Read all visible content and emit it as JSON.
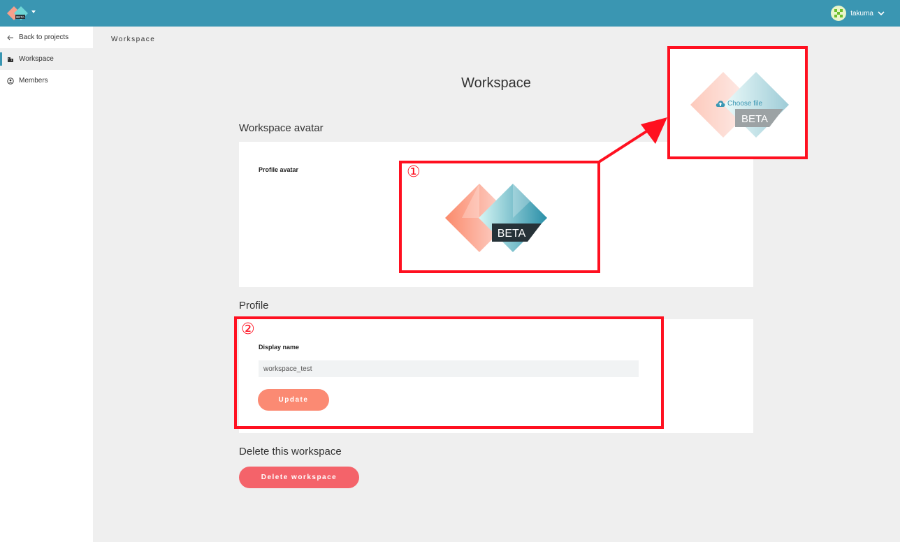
{
  "header": {
    "user_name": "takuma",
    "logo_badge": "BETA"
  },
  "sidebar": {
    "items": [
      {
        "label": "Back to projects",
        "icon": "arrow-left-icon"
      },
      {
        "label": "Workspace",
        "icon": "building-icon",
        "active": true
      },
      {
        "label": "Members",
        "icon": "user-circle-icon"
      }
    ]
  },
  "breadcrumb": "Workspace",
  "page": {
    "title": "Workspace"
  },
  "avatar_section": {
    "heading": "Workspace avatar",
    "field_label": "Profile avatar",
    "badge": "BETA"
  },
  "profile_section": {
    "heading": "Profile",
    "field_label": "Display name",
    "display_name_value": "workspace_test",
    "update_label": "Update"
  },
  "delete_section": {
    "heading": "Delete this workspace",
    "button_label": "Delete workspace"
  },
  "annotations": {
    "marker_1": "①",
    "marker_2": "②",
    "choose_file_label": "Choose file",
    "badge": "BETA"
  },
  "colors": {
    "header": "#3a96b2",
    "accent": "#3a96b2",
    "update_button": "#fb8a73",
    "delete_button": "#f4636a",
    "annotation_red": "#ff1020"
  }
}
